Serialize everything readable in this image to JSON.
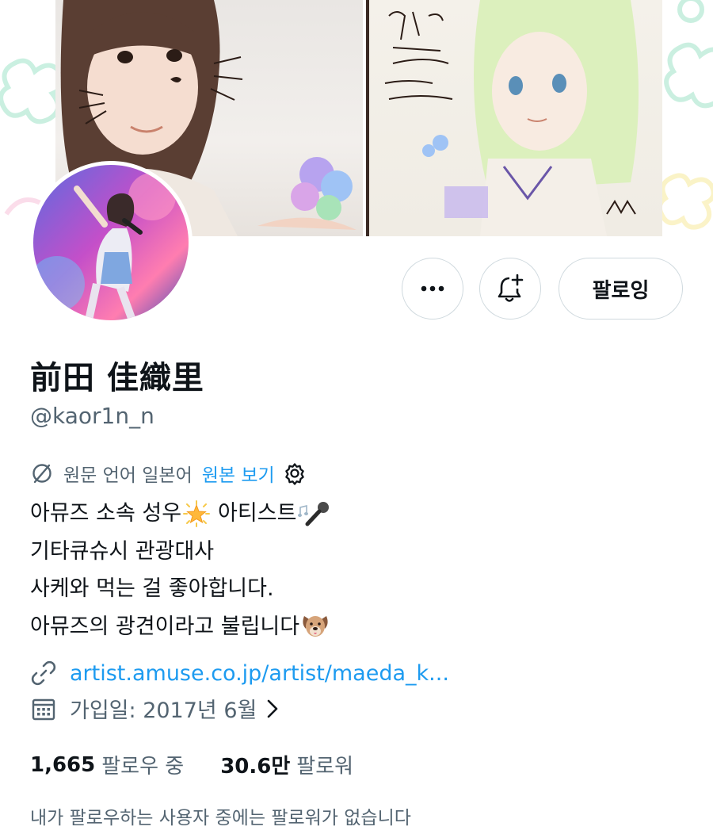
{
  "profile": {
    "display_name": "前田 佳織里",
    "handle": "@kaor1n_n"
  },
  "actions": {
    "more_icon": "more-horizontal-icon",
    "notify_icon": "bell-plus-icon",
    "follow_label": "팔로잉"
  },
  "translation": {
    "icon": "translate-icon",
    "text": "원문 언어 일본어",
    "link": "원본 보기",
    "settings_icon": "gear-icon"
  },
  "bio": {
    "line1_a": "아뮤즈 소속 성우",
    "line1_b": "아티스트",
    "line2": "기타큐슈시 관광대사",
    "line3": "사케와 먹는 걸 좋아합니다.",
    "line4": "아뮤즈의 광견이라고 불립니다"
  },
  "meta": {
    "link_icon": "link-icon",
    "url": "artist.amuse.co.jp/artist/maeda_k...",
    "calendar_icon": "calendar-icon",
    "joined": "가입일: 2017년 6월"
  },
  "stats": {
    "following_count": "1,665",
    "following_label": "팔로우 중",
    "followers_count": "30.6만",
    "followers_label": "팔로워"
  },
  "mutual_note": "내가 팔로우하는 사용자 중에는 팔로워가 없습니다",
  "colors": {
    "accent": "#1d9bf0",
    "text": "#0f1419",
    "secondary": "#536471",
    "border": "#cfd9de"
  }
}
